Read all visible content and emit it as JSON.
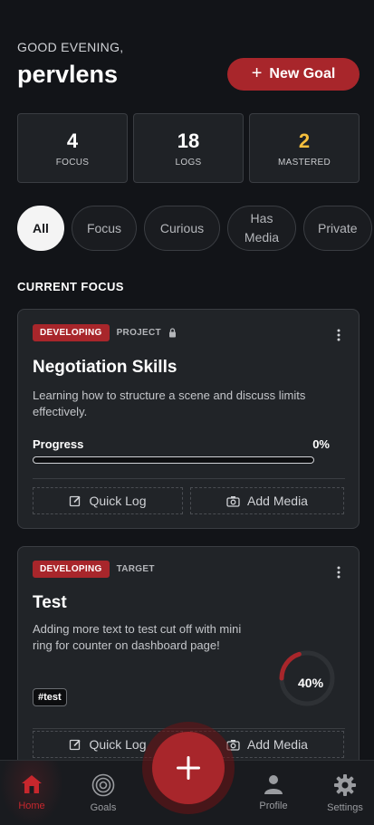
{
  "header": {
    "greeting": "GOOD EVENING,",
    "username": "pervlens",
    "new_goal_label": "New Goal"
  },
  "stats": [
    {
      "value": "4",
      "label": "FOCUS",
      "color": "#ffffff"
    },
    {
      "value": "18",
      "label": "LOGS",
      "color": "#ffffff"
    },
    {
      "value": "2",
      "label": "MASTERED",
      "color": "#f5bf3d"
    }
  ],
  "filters": [
    {
      "label": "All",
      "active": true
    },
    {
      "label": "Focus",
      "active": false
    },
    {
      "label": "Curious",
      "active": false
    },
    {
      "label": "Has Media",
      "active": false
    },
    {
      "label": "Private",
      "active": false
    }
  ],
  "section_title": "CURRENT FOCUS",
  "cards": [
    {
      "status": "DEVELOPING",
      "type": "PROJECT",
      "title": "Negotiation Skills",
      "description": "Learning how to structure a scene and discuss limits effectively.",
      "progress_label": "Progress",
      "progress_text": "0%",
      "progress": 0,
      "quick_log_label": "Quick Log",
      "add_media_label": "Add Media"
    },
    {
      "status": "DEVELOPING",
      "type": "TARGET",
      "title": "Test",
      "description": "Adding more text to test cut off with mini ring for counter on dashboard page!",
      "tag": "#test",
      "ring_text": "40%",
      "ring_value": 0.4,
      "quick_log_label": "Quick Log",
      "add_media_label": "Add Media"
    }
  ],
  "nav": {
    "home": "Home",
    "goals": "Goals",
    "profile": "Profile",
    "settings": "Settings"
  },
  "colors": {
    "accent": "#a8262b",
    "background": "#121418",
    "mastered": "#f5bf3d"
  }
}
